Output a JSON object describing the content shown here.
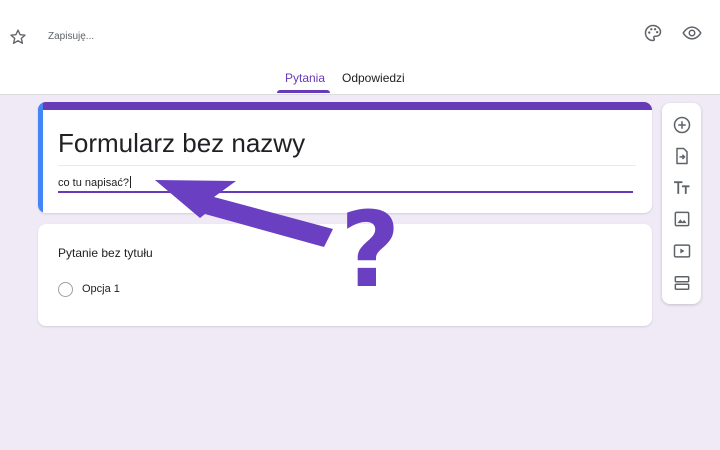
{
  "header": {
    "status": "Zapisuję...",
    "icons": [
      "star-icon",
      "palette-icon",
      "eye-icon"
    ]
  },
  "tabs": [
    {
      "label": "Pytania",
      "active": true
    },
    {
      "label": "Odpowiedzi",
      "active": false
    }
  ],
  "form": {
    "title": "Formularz bez nazwy",
    "description": "co tu napisać?"
  },
  "question": {
    "title": "Pytanie bez tytułu",
    "option": "Opcja 1"
  },
  "toolbar": {
    "icons": [
      "add-question-icon",
      "import-questions-icon",
      "add-title-icon",
      "add-image-icon",
      "add-video-icon",
      "add-section-icon"
    ]
  },
  "annotation": {
    "symbol": "?",
    "color": "#6a3fc2"
  },
  "colors": {
    "accent": "#673ab7",
    "background": "#efeaf6",
    "title_card_left_border": "#4285f4"
  }
}
